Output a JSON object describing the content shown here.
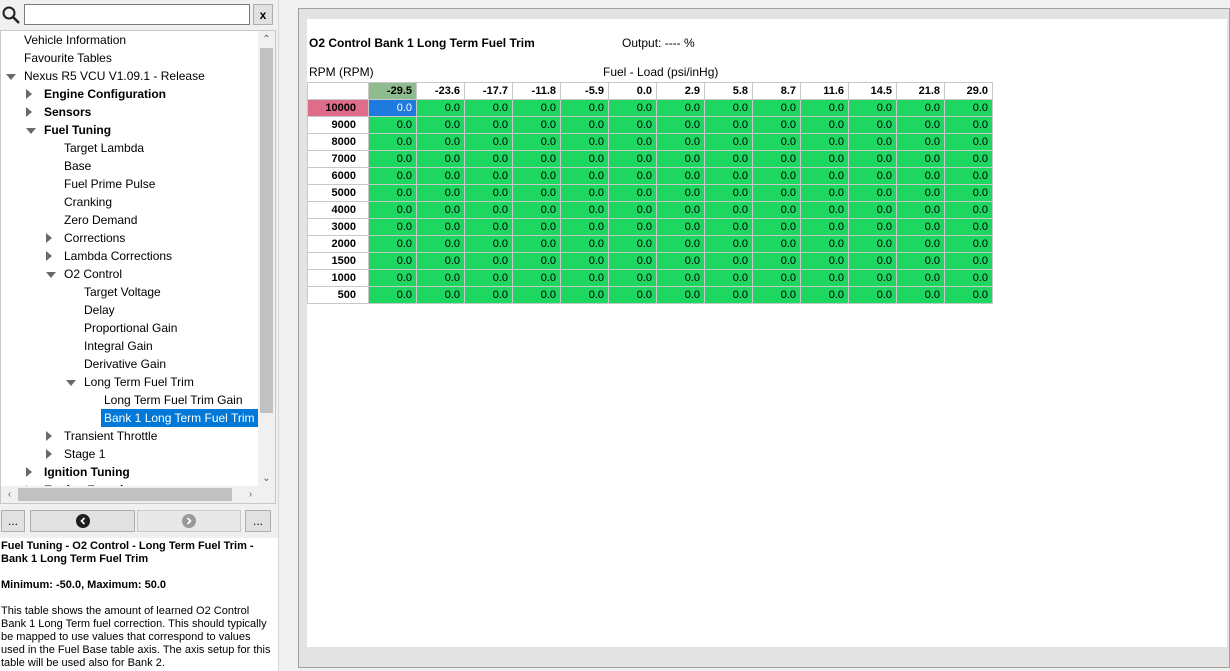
{
  "search": {
    "value": "",
    "clear_label": "x"
  },
  "tree": [
    {
      "label": "Vehicle Information",
      "level": 0,
      "arrow": "none",
      "bold": false
    },
    {
      "label": "Favourite Tables",
      "level": 0,
      "arrow": "none",
      "bold": false
    },
    {
      "label": "Nexus R5 VCU V1.09.1 - Release",
      "level": 0,
      "arrow": "down",
      "bold": false
    },
    {
      "label": "Engine Configuration",
      "level": 1,
      "arrow": "right",
      "bold": true
    },
    {
      "label": "Sensors",
      "level": 1,
      "arrow": "right",
      "bold": true
    },
    {
      "label": "Fuel Tuning",
      "level": 1,
      "arrow": "down",
      "bold": true
    },
    {
      "label": "Target Lambda",
      "level": 2,
      "arrow": "none",
      "bold": false
    },
    {
      "label": "Base",
      "level": 2,
      "arrow": "none",
      "bold": false
    },
    {
      "label": "Fuel Prime Pulse",
      "level": 2,
      "arrow": "none",
      "bold": false
    },
    {
      "label": "Cranking",
      "level": 2,
      "arrow": "none",
      "bold": false
    },
    {
      "label": "Zero Demand",
      "level": 2,
      "arrow": "none",
      "bold": false
    },
    {
      "label": "Corrections",
      "level": 2,
      "arrow": "right",
      "bold": false
    },
    {
      "label": "Lambda Corrections",
      "level": 2,
      "arrow": "right",
      "bold": false
    },
    {
      "label": "O2 Control",
      "level": 2,
      "arrow": "down",
      "bold": false
    },
    {
      "label": "Target Voltage",
      "level": 3,
      "arrow": "none",
      "bold": false
    },
    {
      "label": "Delay",
      "level": 3,
      "arrow": "none",
      "bold": false
    },
    {
      "label": "Proportional Gain",
      "level": 3,
      "arrow": "none",
      "bold": false
    },
    {
      "label": "Integral Gain",
      "level": 3,
      "arrow": "none",
      "bold": false
    },
    {
      "label": "Derivative Gain",
      "level": 3,
      "arrow": "none",
      "bold": false
    },
    {
      "label": "Long Term Fuel Trim",
      "level": 3,
      "arrow": "down",
      "bold": false
    },
    {
      "label": "Long Term Fuel Trim Gain",
      "level": 4,
      "arrow": "none",
      "bold": false
    },
    {
      "label": "Bank 1 Long Term Fuel Trim",
      "level": 4,
      "arrow": "none",
      "bold": false,
      "selected": true
    },
    {
      "label": "Transient Throttle",
      "level": 2,
      "arrow": "right",
      "bold": false
    },
    {
      "label": "Stage 1",
      "level": 2,
      "arrow": "right",
      "bold": false
    },
    {
      "label": "Ignition Tuning",
      "level": 1,
      "arrow": "right",
      "bold": true
    },
    {
      "label": "Engine Functions",
      "level": 1,
      "arrow": "right",
      "bold": true
    }
  ],
  "nav": {
    "left_more": "...",
    "right_more": "..."
  },
  "description": {
    "title": "Fuel Tuning - O2 Control - Long Term Fuel Trim - Bank 1 Long Term Fuel Trim",
    "range": "Minimum: -50.0, Maximum: 50.0",
    "body": "This table shows the amount of learned O2 Control Bank 1 Long Term fuel correction. This should typically be mapped to use values that correspond to values used in the Fuel Base table axis. The axis setup for this table will be used also for Bank 2."
  },
  "table": {
    "title": "O2 Control Bank 1 Long Term Fuel Trim",
    "output": "Output: ---- %",
    "y_axis_label": "RPM (RPM)",
    "x_axis_label": "Fuel - Load (psi/inHg)",
    "columns": [
      "-29.5",
      "-23.6",
      "-17.7",
      "-11.8",
      "-5.9",
      "0.0",
      "2.9",
      "5.8",
      "8.7",
      "11.6",
      "14.5",
      "21.8",
      "29.0"
    ],
    "rows": [
      "10000",
      "9000",
      "8000",
      "7000",
      "6000",
      "5000",
      "4000",
      "3000",
      "2000",
      "1500",
      "1000",
      "500"
    ],
    "cell_value": "0.0",
    "active_row": 0,
    "active_col": 0,
    "colors": {
      "cell": "#1ed760",
      "active_cell": "#1f7ae0",
      "active_row_header": "#e06c8c",
      "active_col_header": "#8fbc8f"
    }
  }
}
